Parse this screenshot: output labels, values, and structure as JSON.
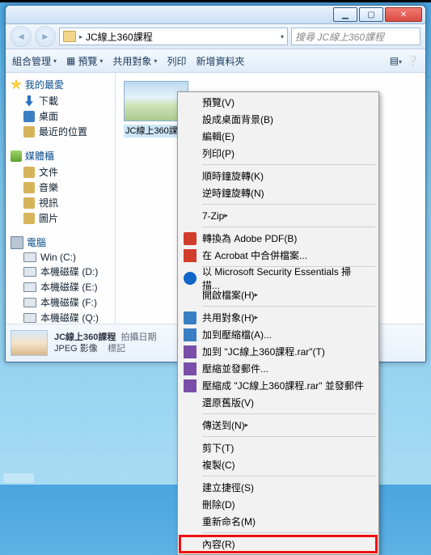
{
  "window": {
    "path_icon": "folder-icon",
    "path_chev": "▸",
    "path_label": "JC線上360課程",
    "search_placeholder": "搜尋 JC線上360課程",
    "cap_min": "▁",
    "cap_max": "▢",
    "cap_close": "✕"
  },
  "toolbar": {
    "organize": "組合管理",
    "preview": "預覽",
    "share": "共用對象",
    "print": "列印",
    "newfolder": "新增資料夾",
    "dd": "▾"
  },
  "sidebar": {
    "fav": "我的最愛",
    "fav_items": [
      "下載",
      "桌面",
      "最近的位置"
    ],
    "lib": "媒體櫃",
    "lib_items": [
      "文件",
      "音樂",
      "視訊",
      "圖片"
    ],
    "pc": "電腦",
    "pc_items": [
      "Win (C:)",
      "本機磁碟 (D:)",
      "本機磁碟 (E:)",
      "本機磁碟 (F:)",
      "本機磁碟 (Q:)"
    ]
  },
  "content": {
    "file_name": "JC線上360課程"
  },
  "details": {
    "name": "JC線上360課程",
    "meta1": "拍攝日期",
    "meta2": "JPEG 影像",
    "meta3": "標記"
  },
  "ctx": {
    "preview": "預覽(V)",
    "setbg": "設成桌面背景(B)",
    "edit": "編輯(E)",
    "print": "列印(P)",
    "rotr": "順時鐘旋轉(K)",
    "rotl": "逆時鐘旋轉(N)",
    "sevenzip": "7-Zip",
    "topdf": "轉換為 Adobe PDF(B)",
    "acrobat": "在 Acrobat 中合併檔案...",
    "mse": "以 Microsoft Security Essentials 掃描...",
    "openwith": "開啟檔案(H)",
    "share": "共用對象(H)",
    "addzip": "加到壓縮檔(A)...",
    "addrar": "加到 \"JC線上360課程.rar\"(T)",
    "zipmail": "壓縮並發郵件...",
    "zipmailrar": "壓縮成 \"JC線上360課程.rar\" 並發郵件",
    "restore": "還原舊版(V)",
    "sendto": "傳送到(N)",
    "cut": "剪下(T)",
    "copy": "複製(C)",
    "shortcut": "建立捷徑(S)",
    "delete": "刪除(D)",
    "rename": "重新命名(M)",
    "properties": "內容(R)",
    "arrow": "▸"
  }
}
